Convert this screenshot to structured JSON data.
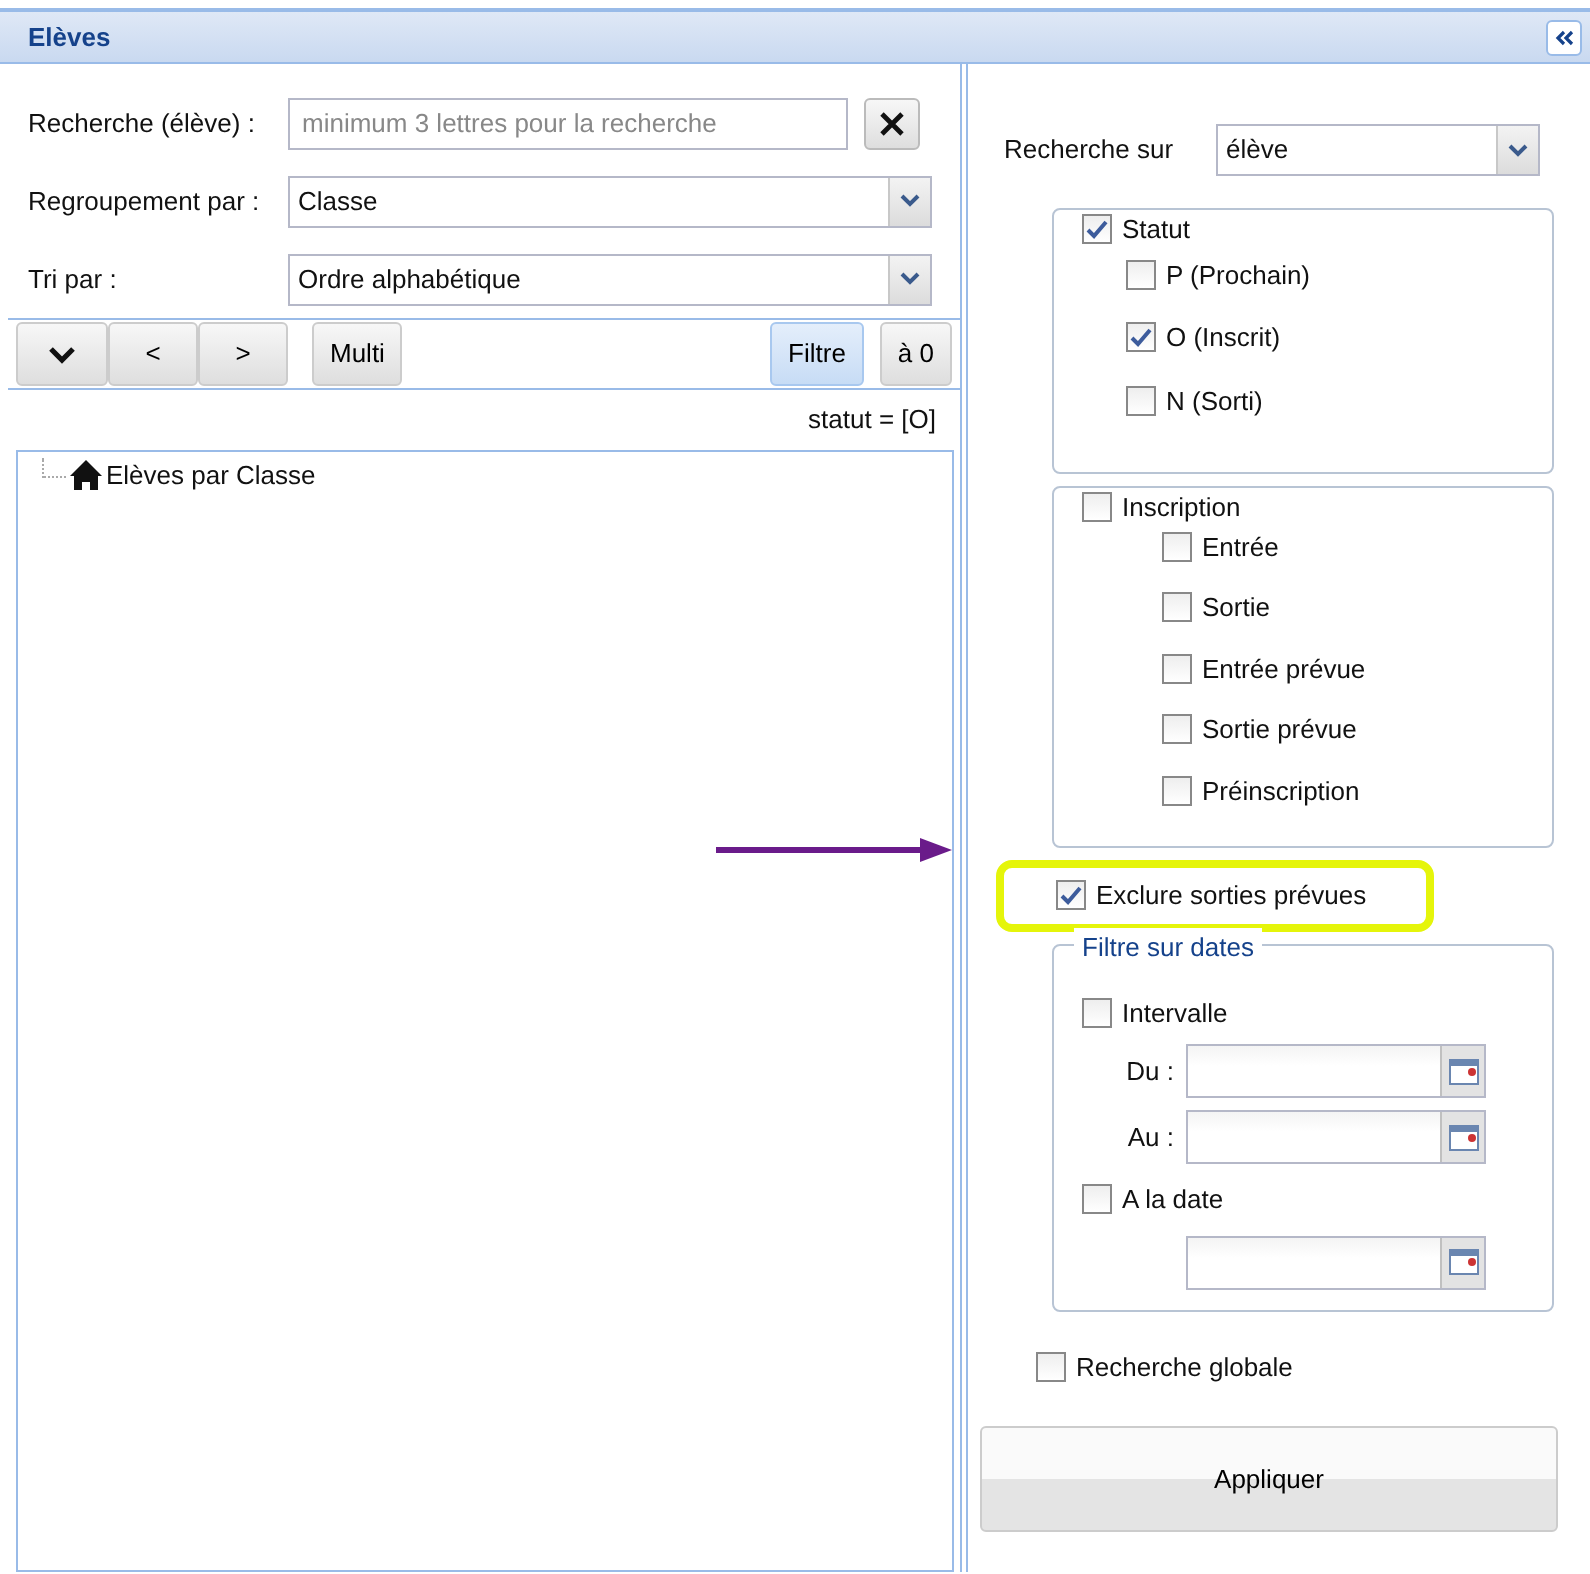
{
  "panel": {
    "title": "Elèves"
  },
  "search": {
    "label": "Recherche (élève) :",
    "placeholder": "minimum 3 lettres pour la recherche"
  },
  "grouping": {
    "label": "Regroupement par :",
    "value": "Classe"
  },
  "sort": {
    "label": "Tri par :",
    "value": "Ordre alphabétique"
  },
  "toolbar": [
    {
      "kind": "expand",
      "selected": false
    },
    {
      "kind": "text",
      "label": "<",
      "selected": false
    },
    {
      "kind": "text",
      "label": ">",
      "selected": false
    },
    {
      "kind": "text",
      "label": "Multi",
      "selected": false
    },
    {
      "kind": "text",
      "label": "Filtre",
      "selected": true
    },
    {
      "kind": "text",
      "label": "à 0",
      "selected": false
    }
  ],
  "filter_summary": "statut = [O]",
  "tree": [
    {
      "label": "Elèves par Classe"
    }
  ],
  "search_on": {
    "label": "Recherche sur",
    "value": "élève"
  },
  "groups": [
    {
      "label": "Statut",
      "checked": true,
      "children": [
        {
          "label": "P (Prochain)",
          "checked": false
        },
        {
          "label": "O (Inscrit)",
          "checked": true
        },
        {
          "label": "N (Sorti)",
          "checked": false
        }
      ]
    },
    {
      "label": "Inscription",
      "checked": false,
      "children": [
        {
          "label": "Entrée",
          "checked": false
        },
        {
          "label": "Sortie",
          "checked": false
        },
        {
          "label": "Entrée prévue",
          "checked": false
        },
        {
          "label": "Sortie prévue",
          "checked": false
        },
        {
          "label": "Préinscription",
          "checked": false
        }
      ]
    }
  ],
  "exclude": {
    "label": "Exclure sorties prévues",
    "checked": true,
    "highlighted": true
  },
  "date_filter": {
    "legend": "Filtre sur dates",
    "interval": {
      "label": "Intervalle",
      "checked": false
    },
    "from": {
      "label": "Du :"
    },
    "to": {
      "label": "Au :"
    },
    "at_date": {
      "label": "A la date",
      "checked": false
    }
  },
  "global_search": {
    "label": "Recherche globale",
    "checked": false
  },
  "apply_button": "Appliquer"
}
